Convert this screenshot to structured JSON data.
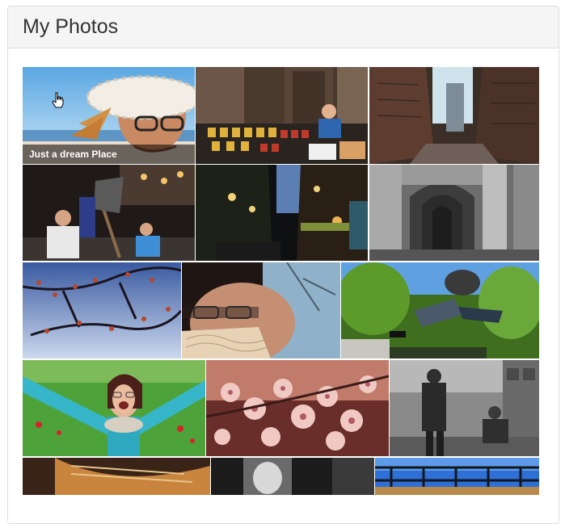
{
  "panel": {
    "title": "My Photos"
  },
  "gallery": {
    "featured_caption": "Just a dream Place",
    "photo_descriptions": [
      "woman in straw hat with glasses",
      "market stall with preserved jars",
      "narrow stone alley",
      "street artist painting",
      "night street with lights",
      "arched colonnade black and white",
      "blossoming tree branches against sky",
      "woman with glasses close-up",
      "person jumping in park",
      "laughing woman in field",
      "pink cherry blossoms",
      "street photographers black and white",
      "hammock detail",
      "dark black and white scene",
      "bridge railing over river"
    ]
  }
}
